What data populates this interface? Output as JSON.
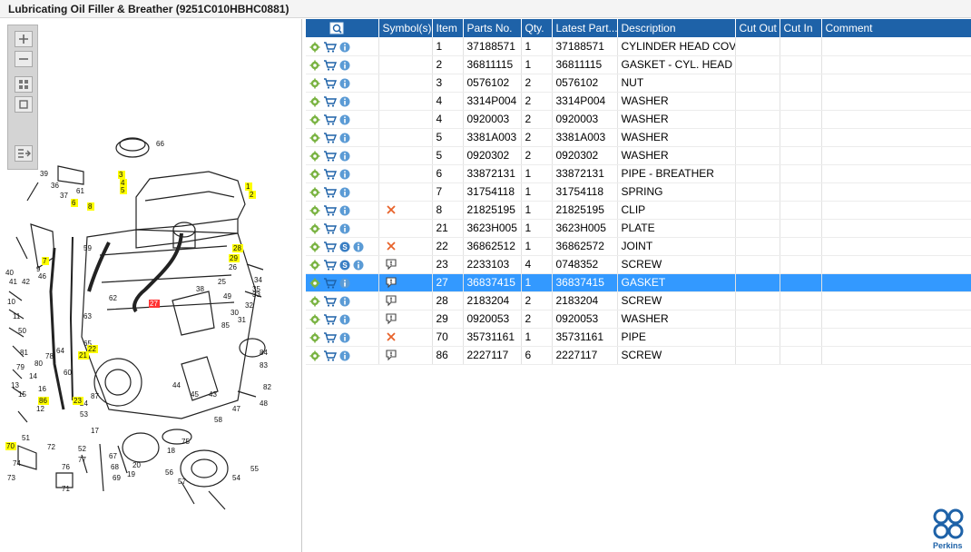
{
  "title": "Lubricating Oil Filler & Breather (9251C010HBHC0881)",
  "toolbar": {
    "zoom_in": "zoom-in",
    "zoom_out": "zoom-out",
    "fit": "fit-view",
    "reset": "reset-view",
    "export": "export"
  },
  "columns": [
    "",
    "Symbol(s)",
    "Item",
    "Parts No.",
    "Qty.",
    "Latest Part...",
    "Description",
    "Cut Out",
    "Cut In",
    "Comment"
  ],
  "rows": [
    {
      "symbols": [],
      "item": "1",
      "part": "37188571",
      "qty": "1",
      "latest": "37188571",
      "desc": "CYLINDER HEAD COVER"
    },
    {
      "symbols": [],
      "item": "2",
      "part": "36811115",
      "qty": "1",
      "latest": "36811115",
      "desc": "GASKET - CYL. HEAD COV"
    },
    {
      "symbols": [],
      "item": "3",
      "part": "0576102",
      "qty": "2",
      "latest": "0576102",
      "desc": "NUT"
    },
    {
      "symbols": [],
      "item": "4",
      "part": "3314P004",
      "qty": "2",
      "latest": "3314P004",
      "desc": "WASHER"
    },
    {
      "symbols": [],
      "item": "4",
      "part": "0920003",
      "qty": "2",
      "latest": "0920003",
      "desc": "WASHER"
    },
    {
      "symbols": [],
      "item": "5",
      "part": "3381A003",
      "qty": "2",
      "latest": "3381A003",
      "desc": "WASHER"
    },
    {
      "symbols": [],
      "item": "5",
      "part": "0920302",
      "qty": "2",
      "latest": "0920302",
      "desc": "WASHER"
    },
    {
      "symbols": [],
      "item": "6",
      "part": "33872131",
      "qty": "1",
      "latest": "33872131",
      "desc": "PIPE - BREATHER"
    },
    {
      "symbols": [],
      "item": "7",
      "part": "31754118",
      "qty": "1",
      "latest": "31754118",
      "desc": "SPRING"
    },
    {
      "symbols": [
        "cross"
      ],
      "item": "8",
      "part": "21825195",
      "qty": "1",
      "latest": "21825195",
      "desc": "CLIP"
    },
    {
      "symbols": [],
      "item": "21",
      "part": "3623H005",
      "qty": "1",
      "latest": "3623H005",
      "desc": "PLATE"
    },
    {
      "symbols": [
        "cross"
      ],
      "item": "22",
      "part": "36862512",
      "qty": "1",
      "latest": "36862572",
      "desc": "JOINT",
      "service": true
    },
    {
      "symbols": [
        "bubble"
      ],
      "item": "23",
      "part": "2233103",
      "qty": "4",
      "latest": "0748352",
      "desc": "SCREW",
      "service": true
    },
    {
      "symbols": [
        "bubble"
      ],
      "item": "27",
      "part": "36837415",
      "qty": "1",
      "latest": "36837415",
      "desc": "GASKET",
      "selected": true
    },
    {
      "symbols": [
        "bubble"
      ],
      "item": "28",
      "part": "2183204",
      "qty": "2",
      "latest": "2183204",
      "desc": "SCREW"
    },
    {
      "symbols": [
        "bubble"
      ],
      "item": "29",
      "part": "0920053",
      "qty": "2",
      "latest": "0920053",
      "desc": "WASHER"
    },
    {
      "symbols": [
        "cross"
      ],
      "item": "70",
      "part": "35731161",
      "qty": "1",
      "latest": "35731161",
      "desc": "PIPE"
    },
    {
      "symbols": [
        "bubble"
      ],
      "item": "86",
      "part": "2227117",
      "qty": "6",
      "latest": "2227117",
      "desc": "SCREW"
    }
  ],
  "callouts_highlighted": [
    "1",
    "2",
    "3",
    "4",
    "5",
    "6",
    "7",
    "8",
    "21",
    "22",
    "23",
    "27",
    "28",
    "29",
    "70",
    "86"
  ],
  "callouts_plain": [
    "66",
    "39",
    "36",
    "37",
    "61",
    "59",
    "9",
    "40",
    "41",
    "42",
    "46",
    "10",
    "11",
    "50",
    "62",
    "63",
    "64",
    "65",
    "81",
    "79",
    "80",
    "78",
    "13",
    "14",
    "15",
    "16",
    "12",
    "60",
    "22",
    "24",
    "87",
    "53",
    "51",
    "17",
    "72",
    "52",
    "77",
    "74",
    "73",
    "76",
    "71",
    "67",
    "68",
    "69",
    "20",
    "19",
    "18",
    "75",
    "56",
    "57",
    "55",
    "54",
    "58",
    "47",
    "48",
    "82",
    "43",
    "44",
    "45",
    "46",
    "84",
    "83",
    "31",
    "30",
    "32",
    "33",
    "34",
    "35",
    "26",
    "25",
    "49",
    "85",
    "38"
  ],
  "logo": {
    "name": "Perkins",
    "color": "#1e62a8"
  },
  "colors": {
    "header": "#1e62a8",
    "selected": "#3399ff",
    "cross": "#e8622a"
  }
}
